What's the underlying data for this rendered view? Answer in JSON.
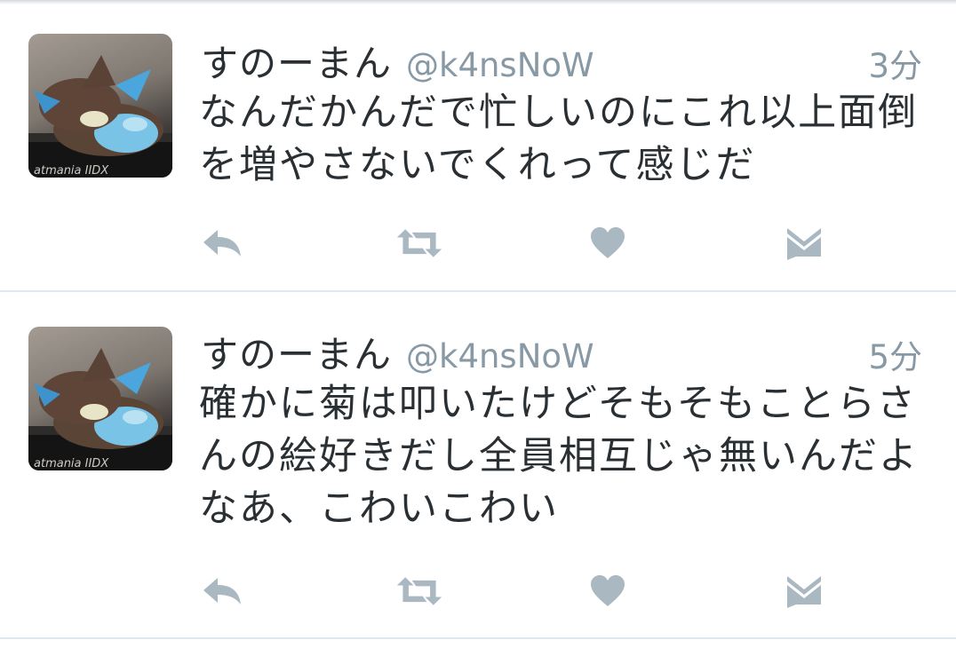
{
  "colors": {
    "name_text": "#292f33",
    "meta_text": "#8899a6",
    "icon": "#aab8c2",
    "divider": "#e1e8ed"
  },
  "tweets": [
    {
      "display_name": "すのーまん",
      "handle": "@k4nsNoW",
      "time": "3分",
      "text": "なんだかんだで忙しいのにこれ以上面倒を増やさないでくれって感じだ",
      "avatar_caption": "atmania IIDX",
      "actions": [
        "reply-icon",
        "retweet-icon",
        "heart-icon",
        "envelope-icon"
      ]
    },
    {
      "display_name": "すのーまん",
      "handle": "@k4nsNoW",
      "time": "5分",
      "text": "確かに菊は叩いたけどそもそもことらさんの絵好きだし全員相互じゃ無いんだよなあ、こわいこわい",
      "avatar_caption": "atmania IIDX",
      "actions": [
        "reply-icon",
        "retweet-icon",
        "heart-icon",
        "envelope-icon"
      ]
    }
  ]
}
